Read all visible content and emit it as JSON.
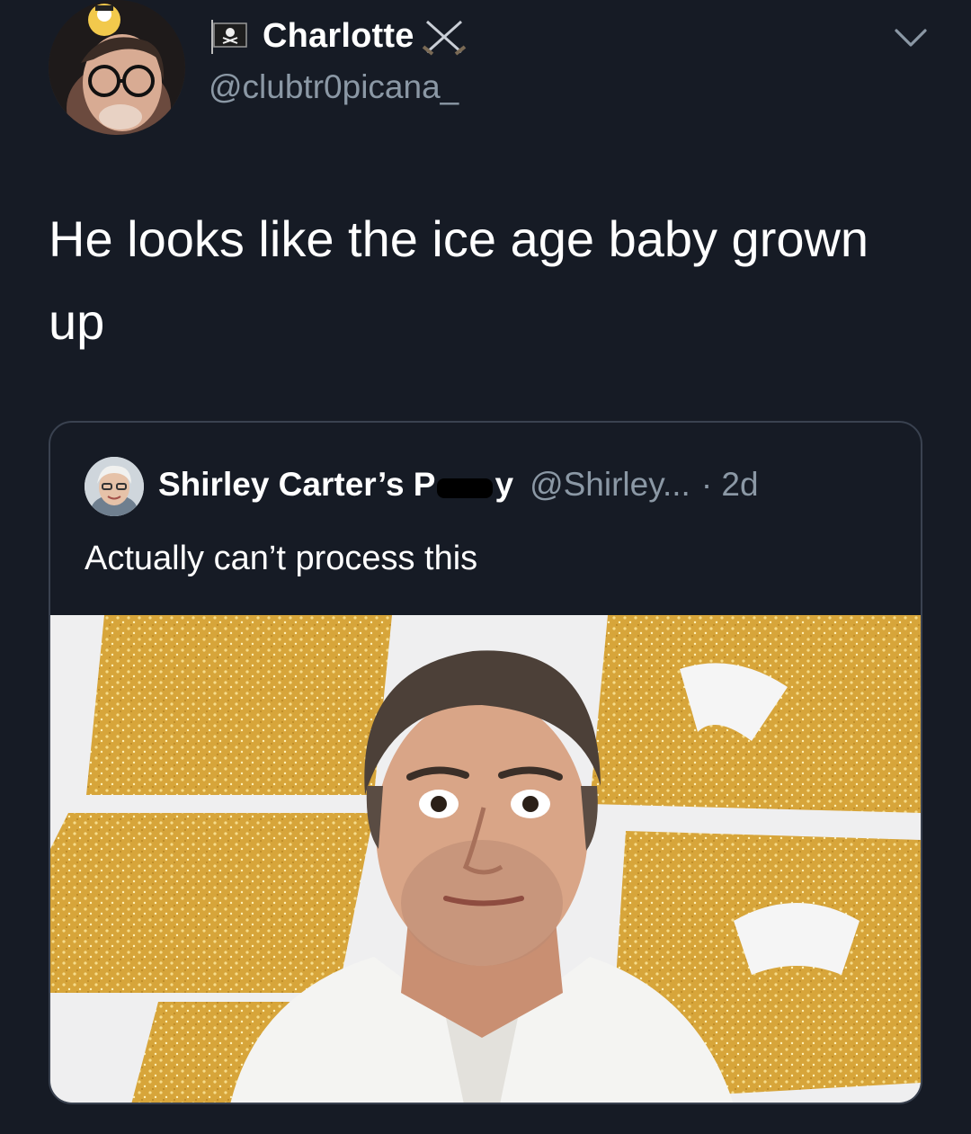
{
  "tweet": {
    "display_name": "Charlotte",
    "handle": "@clubtr0picana_",
    "text": "He looks like the ice age baby grown up"
  },
  "quoted_tweet": {
    "name_start": "Shirley Carter’s P",
    "name_end": "y",
    "handle": "@Shirley...",
    "time": "· 2d",
    "text": "Actually can’t process this"
  },
  "icons": {
    "header_flag": "pirate-flag-icon",
    "header_swords": "crossed-swords-icon",
    "menu": "chevron-down-icon"
  },
  "colors": {
    "background": "#161b25",
    "secondary_text": "#8b98a5",
    "card_border": "#3a4250"
  }
}
